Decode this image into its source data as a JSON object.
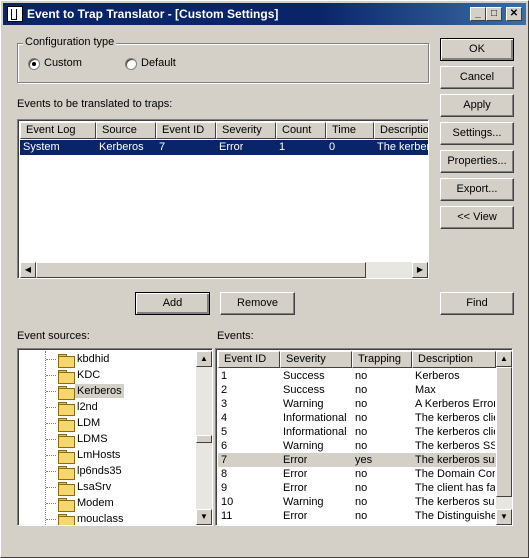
{
  "window": {
    "title": "Event to Trap Translator - [Custom Settings]",
    "controls": {
      "minimize": "_",
      "maximize": "□",
      "close": "✕"
    }
  },
  "config": {
    "label": "Configuration type",
    "custom": "Custom",
    "default": "Default",
    "selected": "Custom"
  },
  "events_label": "Events to be translated to traps:",
  "trap_table": {
    "headers": [
      "Event Log",
      "Source",
      "Event ID",
      "Severity",
      "Count",
      "Time",
      "Description"
    ],
    "rows": [
      [
        "System",
        "Kerberos",
        "7",
        "Error",
        "1",
        "0",
        "The kerberos"
      ]
    ]
  },
  "buttons": {
    "ok": "OK",
    "cancel": "Cancel",
    "apply": "Apply",
    "settings": "Settings...",
    "properties": "Properties...",
    "export": "Export...",
    "view": "<< View",
    "add": "Add",
    "remove": "Remove",
    "find": "Find"
  },
  "sources_label": "Event sources:",
  "sources": [
    "kbdhid",
    "KDC",
    "Kerberos",
    "l2nd",
    "LDM",
    "LDMS",
    "LmHosts",
    "lp6nds35",
    "LsaSrv",
    "Modem",
    "mouclass"
  ],
  "selected_source": "Kerberos",
  "events_list_label": "Events:",
  "events_table": {
    "headers": [
      "Event ID",
      "Severity",
      "Trapping",
      "Description"
    ],
    "rows": [
      [
        "1",
        "Success",
        "no",
        "Kerberos"
      ],
      [
        "2",
        "Success",
        "no",
        "Max"
      ],
      [
        "3",
        "Warning",
        "no",
        "A Kerberos Error"
      ],
      [
        "4",
        "Informational",
        "no",
        "The kerberos clie"
      ],
      [
        "5",
        "Informational",
        "no",
        "The kerberos clie"
      ],
      [
        "6",
        "Warning",
        "no",
        "The kerberos SSF"
      ],
      [
        "7",
        "Error",
        "yes",
        "The kerberos sub"
      ],
      [
        "8",
        "Error",
        "no",
        "The Domain Cor"
      ],
      [
        "9",
        "Error",
        "no",
        "The client has fa"
      ],
      [
        "10",
        "Warning",
        "no",
        "The kerberos sub"
      ],
      [
        "11",
        "Error",
        "no",
        "The Distinguishe"
      ]
    ],
    "highlighted_row": 6
  }
}
